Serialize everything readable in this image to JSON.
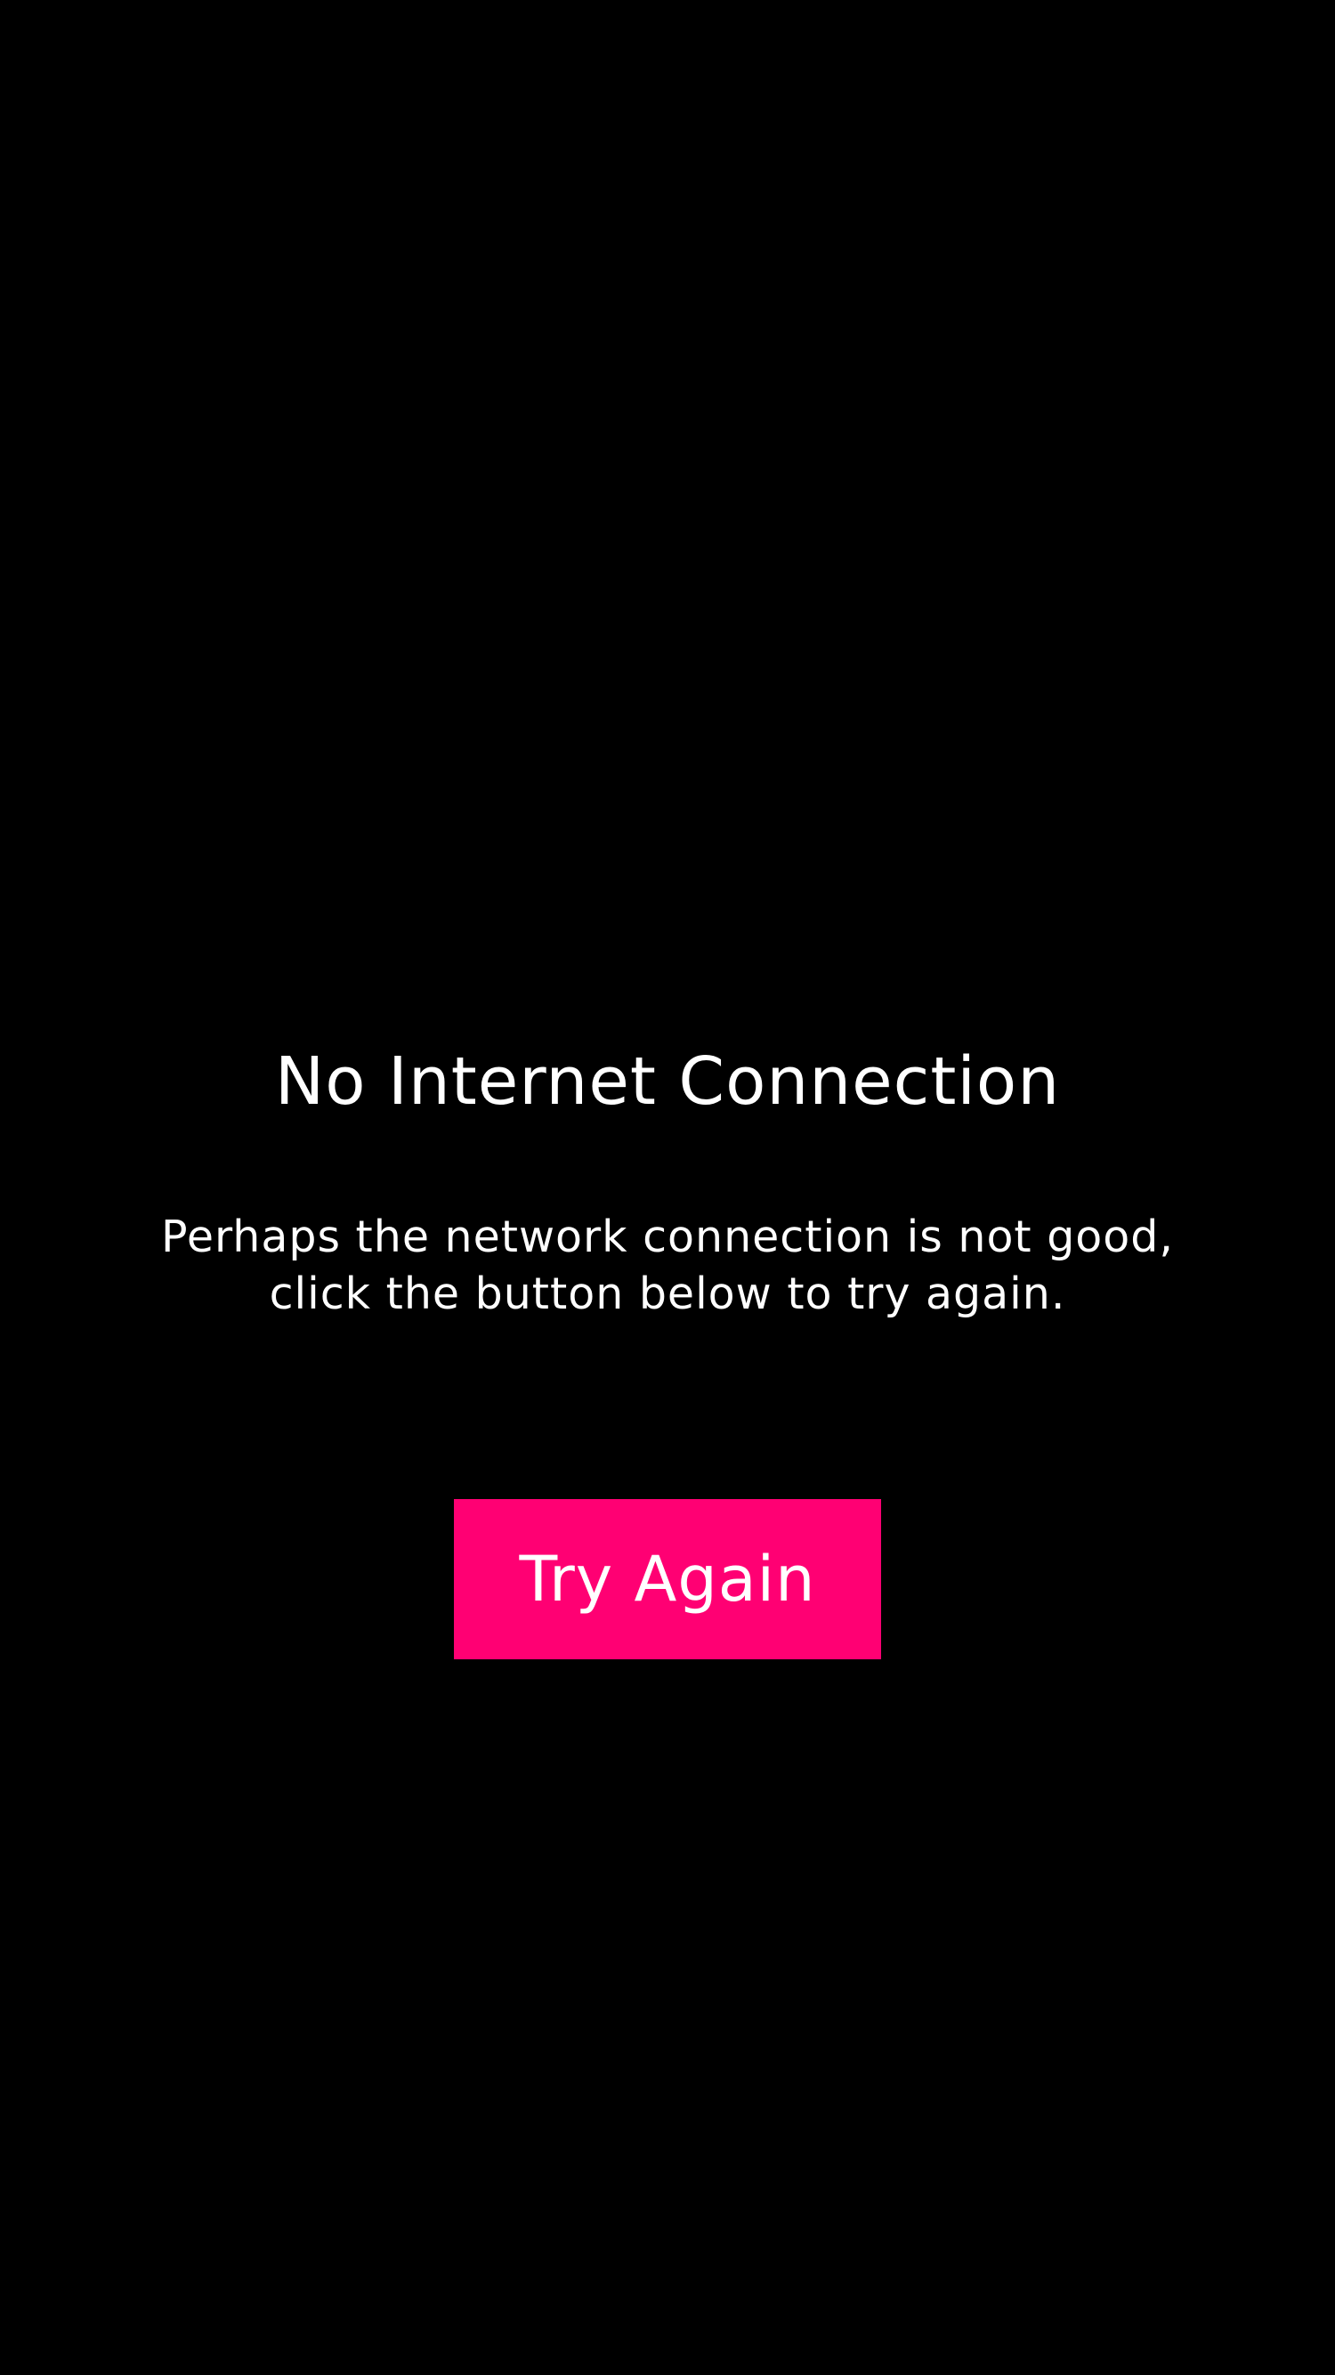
{
  "error": {
    "title": "No Internet Connection",
    "message": "Perhaps the network connection is not good, click the button below to try again.",
    "retry_label": "Try Again"
  },
  "colors": {
    "background": "#000000",
    "text": "#ffffff",
    "accent": "#ff0073"
  }
}
